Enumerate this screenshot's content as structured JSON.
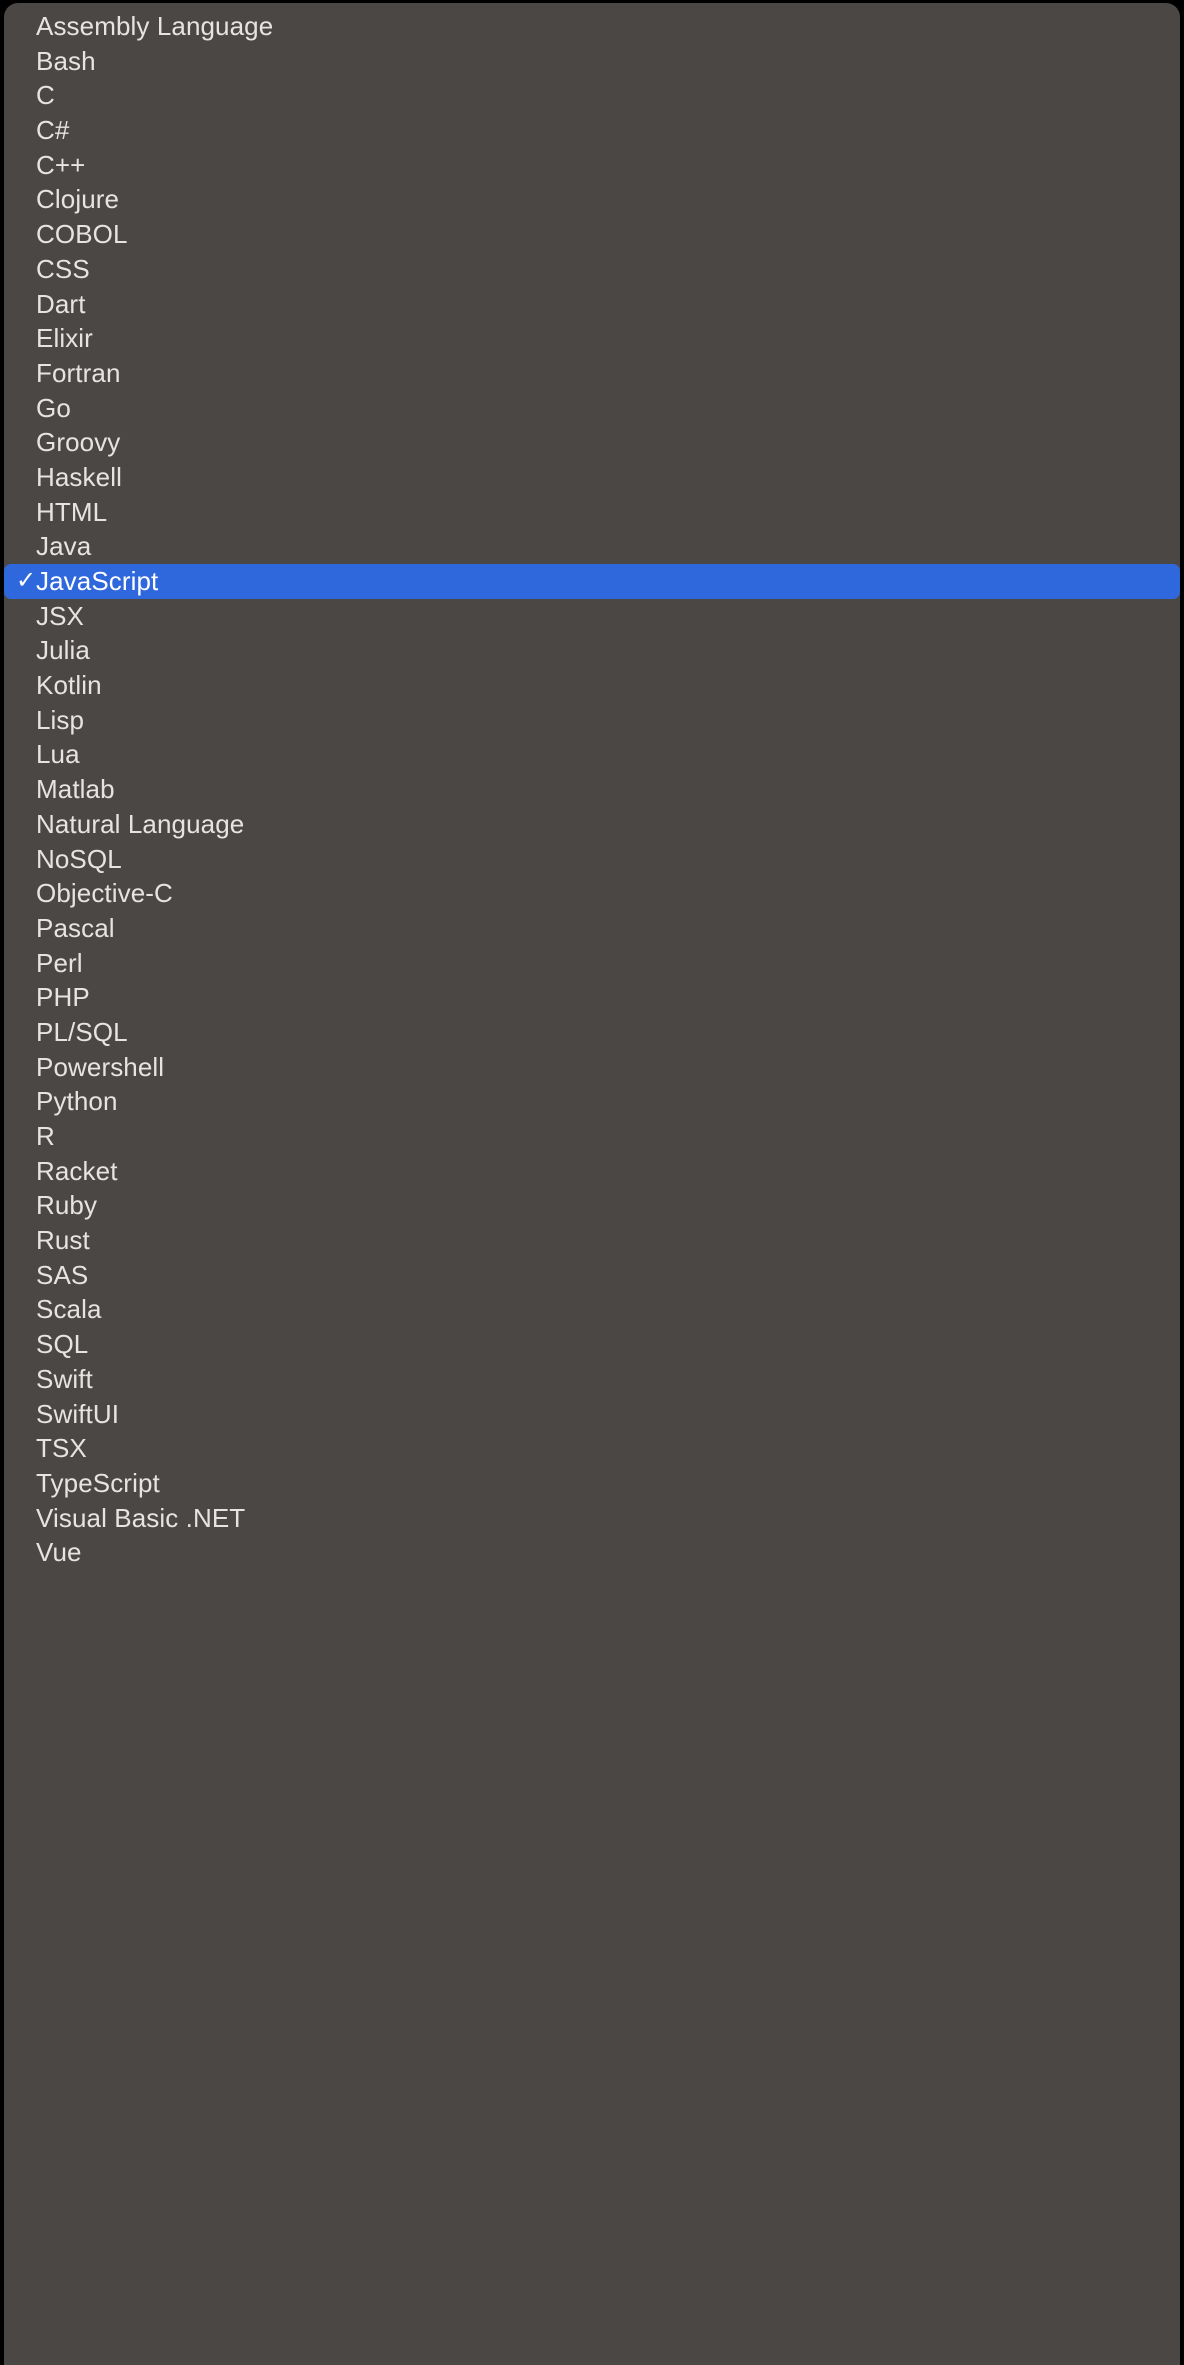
{
  "menu": {
    "kind": "language-picker-dropdown",
    "background_color": "#4b4745",
    "selection_color": "#2f68dc",
    "text_color": "#e6e4e2",
    "selected_value": "JavaScript",
    "check_glyph": "✓",
    "check_icon_name": "checkmark-icon",
    "items": [
      {
        "label": "Assembly Language",
        "selected": false
      },
      {
        "label": "Bash",
        "selected": false
      },
      {
        "label": "C",
        "selected": false
      },
      {
        "label": "C#",
        "selected": false
      },
      {
        "label": "C++",
        "selected": false
      },
      {
        "label": "Clojure",
        "selected": false
      },
      {
        "label": "COBOL",
        "selected": false
      },
      {
        "label": "CSS",
        "selected": false
      },
      {
        "label": "Dart",
        "selected": false
      },
      {
        "label": "Elixir",
        "selected": false
      },
      {
        "label": "Fortran",
        "selected": false
      },
      {
        "label": "Go",
        "selected": false
      },
      {
        "label": "Groovy",
        "selected": false
      },
      {
        "label": "Haskell",
        "selected": false
      },
      {
        "label": "HTML",
        "selected": false
      },
      {
        "label": "Java",
        "selected": false
      },
      {
        "label": "JavaScript",
        "selected": true
      },
      {
        "label": "JSX",
        "selected": false
      },
      {
        "label": "Julia",
        "selected": false
      },
      {
        "label": "Kotlin",
        "selected": false
      },
      {
        "label": "Lisp",
        "selected": false
      },
      {
        "label": "Lua",
        "selected": false
      },
      {
        "label": "Matlab",
        "selected": false
      },
      {
        "label": "Natural Language",
        "selected": false
      },
      {
        "label": "NoSQL",
        "selected": false
      },
      {
        "label": "Objective-C",
        "selected": false
      },
      {
        "label": "Pascal",
        "selected": false
      },
      {
        "label": "Perl",
        "selected": false
      },
      {
        "label": "PHP",
        "selected": false
      },
      {
        "label": "PL/SQL",
        "selected": false
      },
      {
        "label": "Powershell",
        "selected": false
      },
      {
        "label": "Python",
        "selected": false
      },
      {
        "label": "R",
        "selected": false
      },
      {
        "label": "Racket",
        "selected": false
      },
      {
        "label": "Ruby",
        "selected": false
      },
      {
        "label": "Rust",
        "selected": false
      },
      {
        "label": "SAS",
        "selected": false
      },
      {
        "label": "Scala",
        "selected": false
      },
      {
        "label": "SQL",
        "selected": false
      },
      {
        "label": "Swift",
        "selected": false
      },
      {
        "label": "SwiftUI",
        "selected": false
      },
      {
        "label": "TSX",
        "selected": false
      },
      {
        "label": "TypeScript",
        "selected": false
      },
      {
        "label": "Visual Basic .NET",
        "selected": false
      },
      {
        "label": "Vue",
        "selected": false
      }
    ]
  }
}
